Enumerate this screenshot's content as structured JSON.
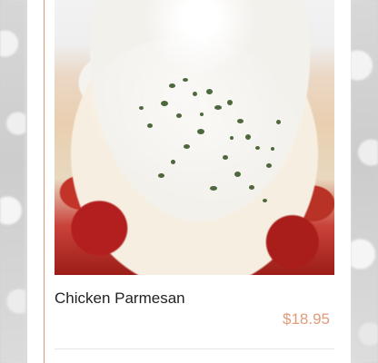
{
  "menu_item": {
    "name": "Chicken Parmesan",
    "price": "$18.95",
    "image_icon": "food-photo-icon"
  },
  "colors": {
    "accent": "#e09b79",
    "divider": "#e6e6e6",
    "text": "#222222"
  }
}
